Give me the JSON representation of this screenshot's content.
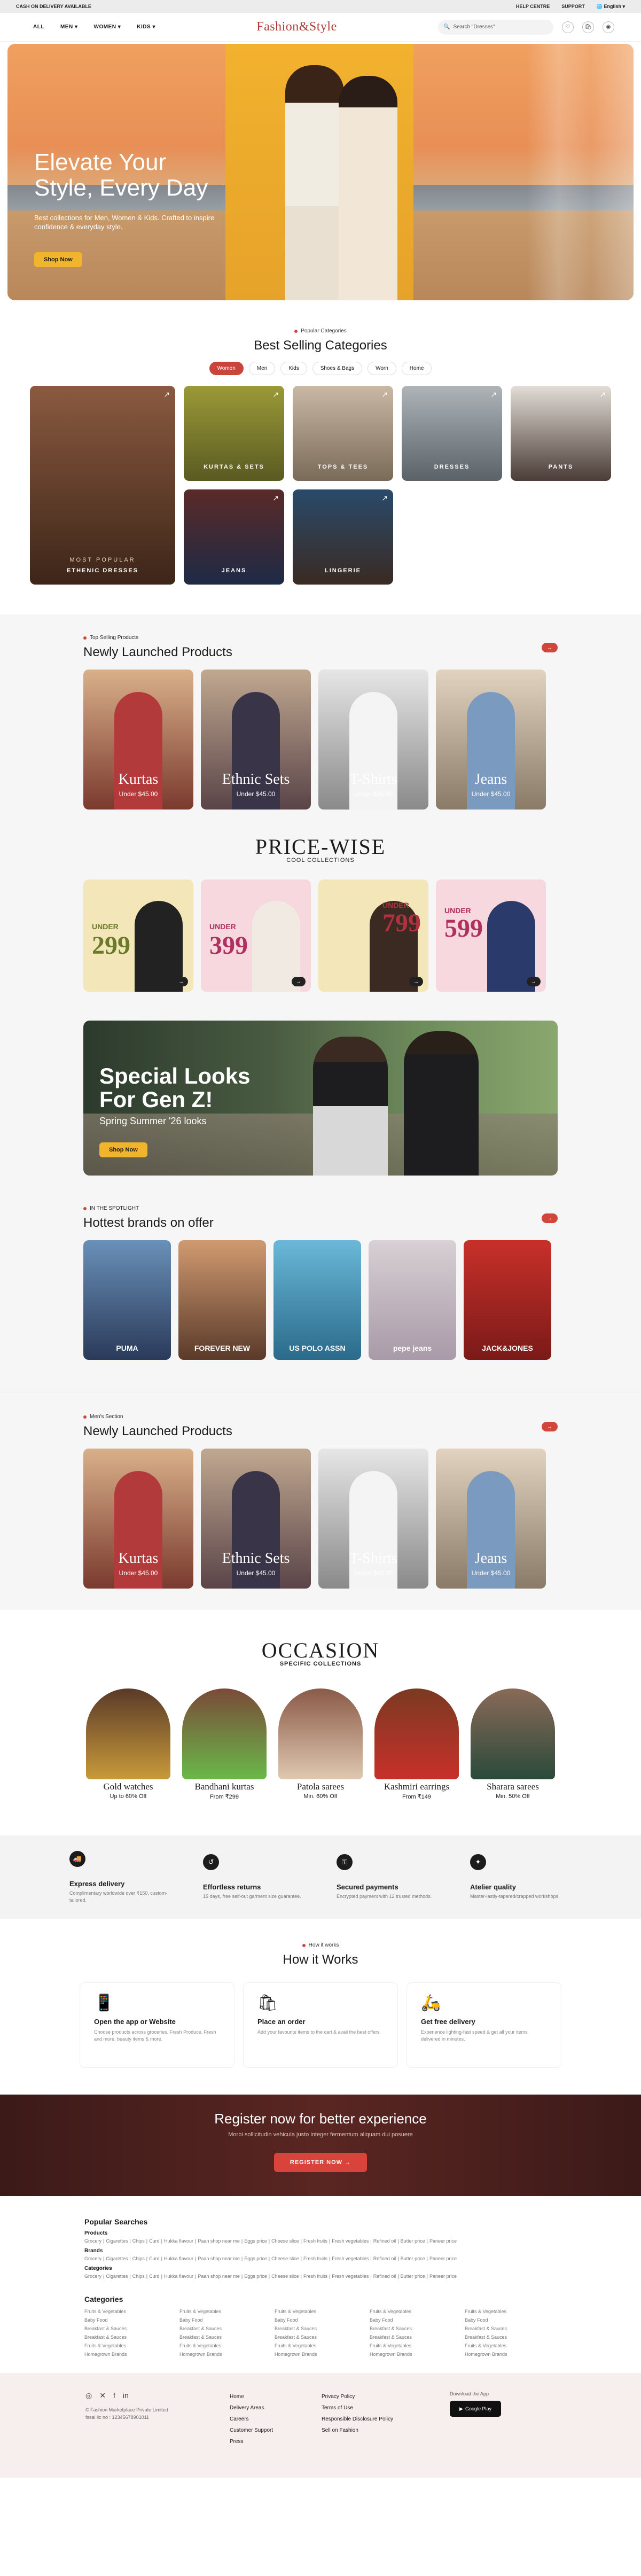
{
  "topbar": {
    "left": "CASH ON DELIVERY AVAILABLE",
    "help": "HELP CENTRE",
    "support": "SUPPORT",
    "lang": "English"
  },
  "header": {
    "logo": "Fashion&Style",
    "nav": [
      "ALL",
      "MEN",
      "WOMEN",
      "KIDS"
    ],
    "search_placeholder": "Search \"Dresses\""
  },
  "hero": {
    "title_line1": "Elevate Your",
    "title_line2": "Style, Every Day",
    "subtitle": "Best collections for Men, Women & Kids. Crafted to inspire confidence & everyday style.",
    "cta": "Shop Now"
  },
  "categories": {
    "kicker": "Popular Categories",
    "title": "Best Selling Categories",
    "tabs": [
      "Women",
      "Men",
      "Kids",
      "Shoes & Bags",
      "Worn",
      "Home"
    ],
    "active_tab": "Women",
    "items": [
      {
        "label": "ETHENIC DRESSES",
        "sub": "MOST POPULAR"
      },
      {
        "label": "KURTAS & SETS"
      },
      {
        "label": "TOPS & TEES"
      },
      {
        "label": "DRESSES"
      },
      {
        "label": "PANTS"
      },
      {
        "label": "JEANS"
      },
      {
        "label": "LINGERIE"
      }
    ]
  },
  "launched": {
    "kicker": "Top Selling Products",
    "title": "Newly Launched Products",
    "items": [
      {
        "name": "Kurtas",
        "price": "Under $45.00"
      },
      {
        "name": "Ethnic Sets",
        "price": "Under $45.00"
      },
      {
        "name": "T-Shirts",
        "price": "Under $45.00"
      },
      {
        "name": "Jeans",
        "price": "Under $45.00"
      }
    ]
  },
  "pricewise": {
    "title": "PRICE-WISE",
    "subtitle": "COOL COLLECTIONS",
    "items": [
      {
        "under": "UNDER",
        "price": "299"
      },
      {
        "under": "UNDER",
        "price": "399"
      },
      {
        "under": "UNDER",
        "price": "799"
      },
      {
        "under": "UNDER",
        "price": "599"
      }
    ]
  },
  "special": {
    "line1": "Special Looks",
    "line2": "For Gen Z!",
    "sub": "Spring Summer '26 looks",
    "cta": "Shop Now"
  },
  "brands": {
    "kicker": "IN THE SPOTLIGHT",
    "title": "Hottest brands on offer",
    "items": [
      "PUMA",
      "FOREVER NEW",
      "US POLO ASSN",
      "pepe jeans",
      "JACK&JONES"
    ]
  },
  "launched2": {
    "kicker": "Men's Section",
    "title": "Newly Launched Products",
    "items": [
      {
        "name": "Kurtas",
        "price": "Under $45.00"
      },
      {
        "name": "Ethnic Sets",
        "price": "Under $45.00"
      },
      {
        "name": "T-Shirts",
        "price": "Under $45.00"
      },
      {
        "name": "Jeans",
        "price": "Under $45.00"
      }
    ]
  },
  "occasion": {
    "title": "OCCASION",
    "subtitle": "SPECIFIC COLLECTIONS",
    "items": [
      {
        "name": "Gold watches",
        "offer": "Up to 60% Off"
      },
      {
        "name": "Bandhani kurtas",
        "offer": "From ₹299"
      },
      {
        "name": "Patola sarees",
        "offer": "Min. 60% Off"
      },
      {
        "name": "Kashmiri earrings",
        "offer": "From ₹149"
      },
      {
        "name": "Sharara sarees",
        "offer": "Min. 50% Off"
      }
    ]
  },
  "features": [
    {
      "title": "Express delivery",
      "desc": "Complimentary worldwide over ₹150, custom-tailored."
    },
    {
      "title": "Effortless returns",
      "desc": "15 days, free self-out garment size guarantee."
    },
    {
      "title": "Secured payments",
      "desc": "Encrypted payment with 12 trusted methods."
    },
    {
      "title": "Atelier quality",
      "desc": "Master-lastly-tapered/crapped workshops."
    }
  ],
  "how": {
    "kicker": "How it works",
    "title": "How it Works",
    "steps": [
      {
        "title": "Open the app or Website",
        "desc": "Choose products across groceries, Fresh Produce, Fresh and more, beauty items & more."
      },
      {
        "title": "Place an order",
        "desc": "Add your favourite items to the cart & avail the best offers."
      },
      {
        "title": "Get free delivery",
        "desc": "Experience lighting-fast speed & get all your items delivered in minutes."
      }
    ]
  },
  "register": {
    "title": "Register now for better experience",
    "sub": "Morbi sollicitudin vehicula justo integer fermentum aliquam dui posuere",
    "cta": "REGISTER NOW →"
  },
  "popular": {
    "title": "Popular Searches",
    "groups": [
      {
        "name": "Products",
        "links": [
          "Grocery",
          "Cigarettes",
          "Chips",
          "Curd",
          "Hukka flavour",
          "Paan shop near me",
          "Eggs price",
          "Cheese slice",
          "Fresh fruits",
          "Fresh vegetables",
          "Refined oil",
          "Butter price",
          "Paneer price"
        ]
      },
      {
        "name": "Brands",
        "links": [
          "Grocery",
          "Cigarettes",
          "Chips",
          "Curd",
          "Hukka flavour",
          "Paan shop near me",
          "Eggs price",
          "Cheese slice",
          "Fresh fruits",
          "Fresh vegetables",
          "Refined oil",
          "Butter price",
          "Paneer price"
        ]
      },
      {
        "name": "Categories",
        "links": [
          "Grocery",
          "Cigarettes",
          "Chips",
          "Curd",
          "Hukka flavour",
          "Paan shop near me",
          "Eggs price",
          "Cheese slice",
          "Fresh fruits",
          "Fresh vegetables",
          "Refined oil",
          "Butter price",
          "Paneer price"
        ]
      }
    ],
    "cat_title": "Categories",
    "cat_items": [
      "Fruits & Vegetables",
      "Baby Food",
      "Breakfast & Sauces",
      "Breakfast & Sauces",
      "Fruits & Vegetables",
      "Homegrown Brands"
    ]
  },
  "footer": {
    "copyright": "© Fashion Marketplace Private Limited",
    "fssai": "fssai lic no : 12345678901011",
    "col1": [
      "Home",
      "Delivery Areas",
      "Careers",
      "Customer Support",
      "Press"
    ],
    "col2": [
      "Privacy Policy",
      "Terms of Use",
      "Responsible Disclosure Policy",
      "Sell on Fashion"
    ],
    "app_label": "Download the App",
    "gp": "Google Play"
  }
}
